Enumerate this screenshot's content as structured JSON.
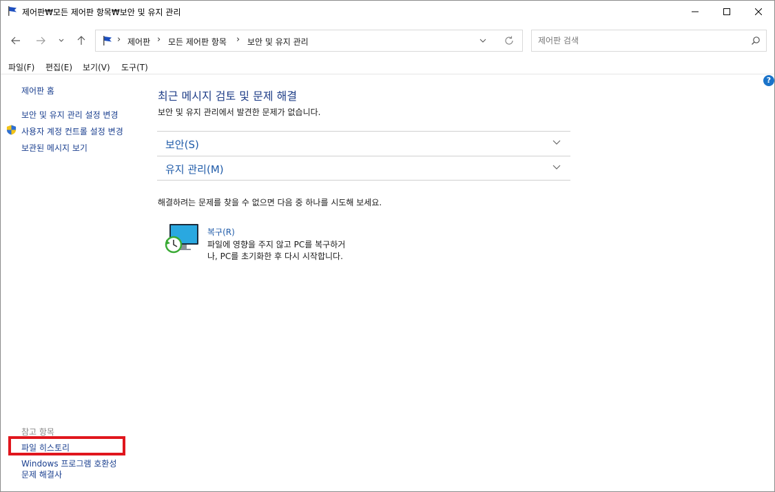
{
  "window": {
    "title": "제어판₩모든 제어판 항목₩보안 및 유지 관리"
  },
  "address": {
    "crumbs": [
      "제어판",
      "모든 제어판 항목",
      "보안 및 유지 관리"
    ]
  },
  "search": {
    "placeholder": "제어판 검색"
  },
  "menu": {
    "items": [
      "파일(F)",
      "편집(E)",
      "보기(V)",
      "도구(T)"
    ]
  },
  "sidebar": {
    "home": "제어판 홈",
    "links": [
      "보안 및 유지 관리 설정 변경",
      "사용자 계정 컨트롤 설정 변경",
      "보관된 메시지 보기"
    ],
    "see_also_label": "참고 항목",
    "see_also": [
      "파일 히스토리",
      "Windows 프로그램 호환성",
      "문제 해결사"
    ]
  },
  "main": {
    "title": "최근 메시지 검토 및 문제 해결",
    "subtitle": "보안 및 유지 관리에서 발견한 문제가 없습니다.",
    "sections": [
      "보안(S)",
      "유지 관리(M)"
    ],
    "hint": "해결하려는 문제를 찾을 수 없으면 다음 중 하나를 시도해 보세요.",
    "recovery": {
      "label": "복구(R)",
      "description": "파일에 영향을 주지 않고 PC를 복구하거나, PC를 초기화한 후 다시 시작합니다."
    }
  },
  "colors": {
    "link": "#1a3f8f",
    "heading": "#1e3d87",
    "highlight": "#e0161d"
  }
}
